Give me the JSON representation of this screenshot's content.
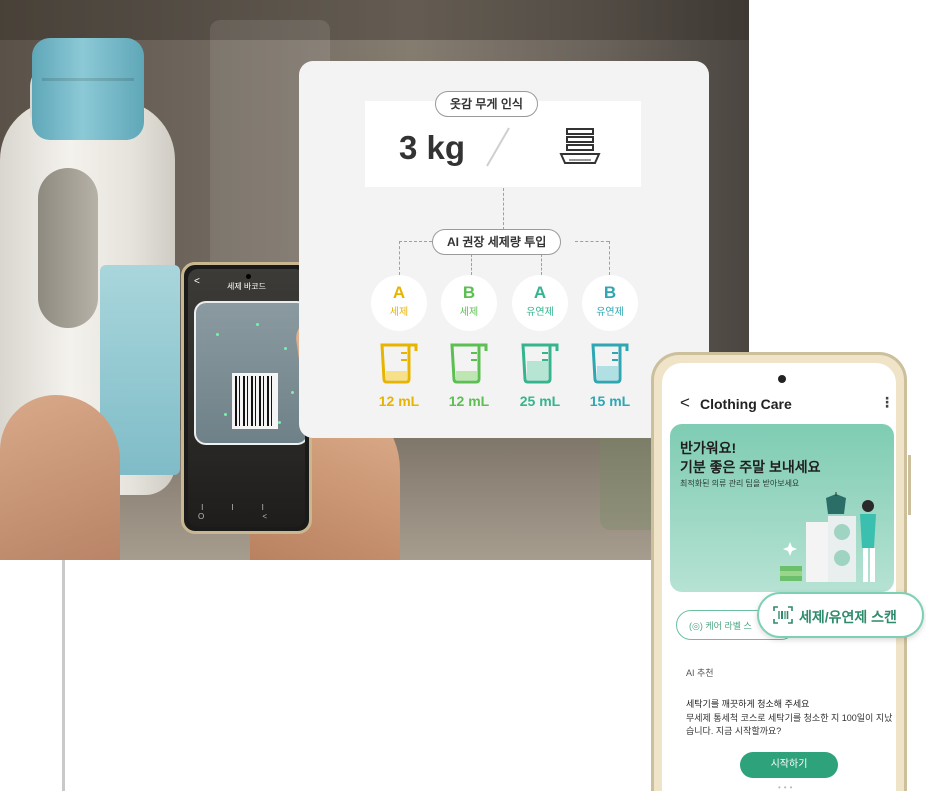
{
  "card": {
    "weight_pill": "옷감 무게 인식",
    "weight_value": "3 kg",
    "ai_pill": "AI 권장 세제량 투입",
    "items": [
      {
        "letter": "A",
        "type": "세제",
        "amount": "12 mL",
        "color": "#e7b400"
      },
      {
        "letter": "B",
        "type": "세제",
        "amount": "12 mL",
        "color": "#5cbf52"
      },
      {
        "letter": "A",
        "type": "유연제",
        "amount": "25 mL",
        "color": "#36b48e"
      },
      {
        "letter": "B",
        "type": "유연제",
        "amount": "15 mL",
        "color": "#2fa7b3"
      }
    ]
  },
  "phone_left": {
    "title": "세제 바코드",
    "back_glyph": "<",
    "navbar": "III O <"
  },
  "phone_right": {
    "back_glyph": "<",
    "title": "Clothing Care",
    "menu_glyph": "⋮",
    "banner_line1": "반가워요!",
    "banner_line2": "기분 좋은 주말 보내세요",
    "banner_line3": "최적화된 의류 관리 팁을 받아보세요",
    "chip_care_label": "케어 라벨 스",
    "section_label": "AI 추천",
    "message_title": "세탁기를 깨끗하게 청소해 주세요",
    "message_body": "무세제 통세척 코스로 세탁기를 청소한 지 100일이 지났습니다. 지금 시작할까요?",
    "start_button": "시작하기",
    "page_dots": "•••"
  },
  "scan_chip": {
    "label": "세제/유연제 스캔"
  },
  "colors": {
    "accent": "#2ea27b",
    "banner": "#7fccb3"
  }
}
